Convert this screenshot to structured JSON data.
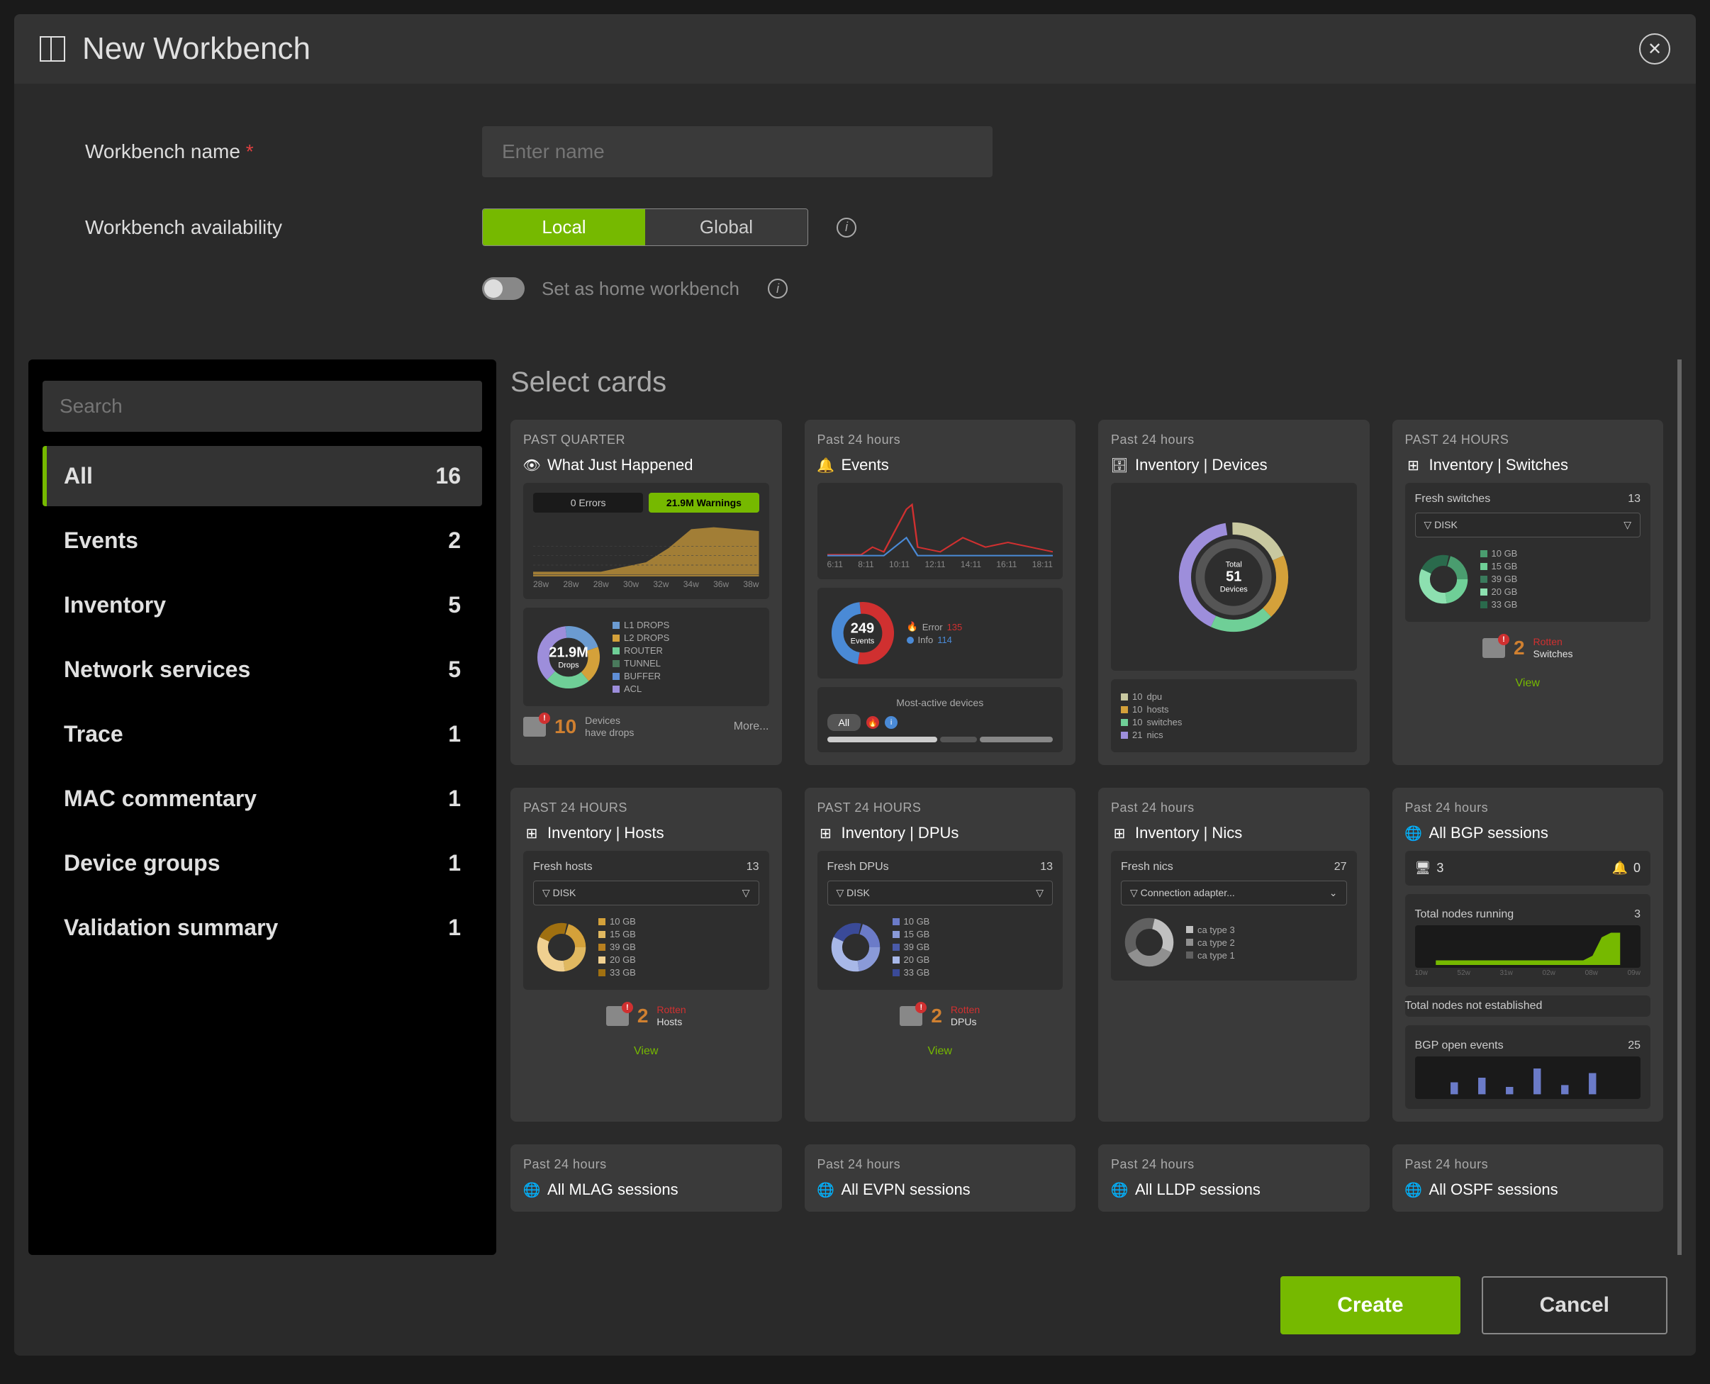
{
  "header": {
    "title": "New Workbench"
  },
  "form": {
    "name_label": "Workbench name",
    "name_placeholder": "Enter name",
    "availability_label": "Workbench availability",
    "availability_options": [
      "Local",
      "Global"
    ],
    "home_label": "Set as home workbench"
  },
  "sidebar": {
    "search_placeholder": "Search",
    "categories": [
      {
        "label": "All",
        "count": "16"
      },
      {
        "label": "Events",
        "count": "2"
      },
      {
        "label": "Inventory",
        "count": "5"
      },
      {
        "label": "Network services",
        "count": "5"
      },
      {
        "label": "Trace",
        "count": "1"
      },
      {
        "label": "MAC commentary",
        "count": "1"
      },
      {
        "label": "Device groups",
        "count": "1"
      },
      {
        "label": "Validation summary",
        "count": "1"
      }
    ]
  },
  "cards_section": {
    "title": "Select cards"
  },
  "cards": {
    "wjh": {
      "time": "PAST QUARTER",
      "title": "What Just Happened",
      "errors": "0 Errors",
      "warnings": "21.9M Warnings",
      "axis": [
        "28w",
        "28w",
        "28w",
        "30w",
        "32w",
        "34w",
        "36w",
        "38w"
      ],
      "donut_big": "21.9M",
      "donut_sm": "Drops",
      "legend": [
        "L1 DROPS",
        "L2 DROPS",
        "ROUTER",
        "TUNNEL",
        "BUFFER",
        "ACL"
      ],
      "legend_colors": [
        "#6b9bd1",
        "#d4a13a",
        "#6fcf97",
        "#4a7a5c",
        "#5f8fd6",
        "#9d8edb"
      ],
      "rotten_num": "10",
      "rotten_txt1": "Devices",
      "rotten_txt2": "have drops",
      "more": "More..."
    },
    "events": {
      "time": "Past 24 hours",
      "title": "Events",
      "axis": [
        "6:11",
        "8:11",
        "10:11",
        "12:11",
        "14:11",
        "16:11",
        "18:11"
      ],
      "donut_big": "249",
      "donut_sm": "Events",
      "error_lbl": "Error",
      "error_v": "135",
      "info_lbl": "Info",
      "info_v": "114",
      "section": "Most-active devices",
      "tab": "All"
    },
    "devices": {
      "time": "Past 24 hours",
      "title": "Inventory | Devices",
      "donut_sm1": "Total",
      "donut_big": "51",
      "donut_sm2": "Devices",
      "legend": [
        {
          "v": "10",
          "l": "dpu",
          "c": "#c8c8a0"
        },
        {
          "v": "10",
          "l": "hosts",
          "c": "#d4a13a"
        },
        {
          "v": "10",
          "l": "switches",
          "c": "#6fcf97"
        },
        {
          "v": "21",
          "l": "nics",
          "c": "#9d8edb"
        }
      ]
    },
    "switches": {
      "time": "PAST 24 HOURS",
      "title": "Inventory | Switches",
      "fresh_lbl": "Fresh switches",
      "fresh_v": "13",
      "filter": "DISK",
      "legend": [
        "10 GB",
        "15 GB",
        "39 GB",
        "20 GB",
        "33 GB"
      ],
      "colors": [
        "#4a9d6f",
        "#6fcf97",
        "#3a7a5c",
        "#8de0b0",
        "#2a6a4c"
      ],
      "rotten_num": "2",
      "rotten_t1": "Rotten",
      "rotten_t2": "Switches",
      "view": "View"
    },
    "hosts": {
      "time": "PAST 24 HOURS",
      "title": "Inventory | Hosts",
      "fresh_lbl": "Fresh hosts",
      "fresh_v": "13",
      "filter": "DISK",
      "legend": [
        "10 GB",
        "15 GB",
        "39 GB",
        "20 GB",
        "33 GB"
      ],
      "colors": [
        "#d4a13a",
        "#e0b860",
        "#b88020",
        "#f0d090",
        "#a07010"
      ],
      "rotten_num": "2",
      "rotten_t1": "Rotten",
      "rotten_t2": "Hosts",
      "view": "View"
    },
    "dpus": {
      "time": "PAST 24 HOURS",
      "title": "Inventory | DPUs",
      "fresh_lbl": "Fresh DPUs",
      "fresh_v": "13",
      "filter": "DISK",
      "legend": [
        "10 GB",
        "15 GB",
        "39 GB",
        "20 GB",
        "33 GB"
      ],
      "colors": [
        "#6b7bc8",
        "#8a9ad8",
        "#4a5aa8",
        "#a8b8e8",
        "#3a4a98"
      ],
      "rotten_num": "2",
      "rotten_t1": "Rotten",
      "rotten_t2": "DPUs",
      "view": "View"
    },
    "nics": {
      "time": "Past 24 hours",
      "title": "Inventory | Nics",
      "fresh_lbl": "Fresh nics",
      "fresh_v": "27",
      "filter": "Connection adapter...",
      "legend": [
        "ca type 3",
        "ca type 2",
        "ca type 1"
      ],
      "colors": [
        "#c0c0c0",
        "#909090",
        "#606060"
      ]
    },
    "bgp": {
      "time": "Past 24 hours",
      "title": "All BGP sessions",
      "metric1_v": "3",
      "metric2_v": "0",
      "row1_lbl": "Total nodes running",
      "row1_v": "3",
      "axis": [
        "10w",
        "52w",
        "31w",
        "02w",
        "08w",
        "09w"
      ],
      "row2_lbl": "Total nodes not established",
      "row2_v": "",
      "row3_lbl": "BGP open events",
      "row3_v": "25"
    },
    "mlag": {
      "time": "Past 24 hours",
      "title": "All MLAG sessions"
    },
    "evpn": {
      "time": "Past 24 hours",
      "title": "All EVPN sessions"
    },
    "lldp": {
      "time": "Past 24 hours",
      "title": "All LLDP sessions"
    },
    "ospf": {
      "time": "Past 24 hours",
      "title": "All OSPF sessions"
    }
  },
  "footer": {
    "create": "Create",
    "cancel": "Cancel"
  }
}
